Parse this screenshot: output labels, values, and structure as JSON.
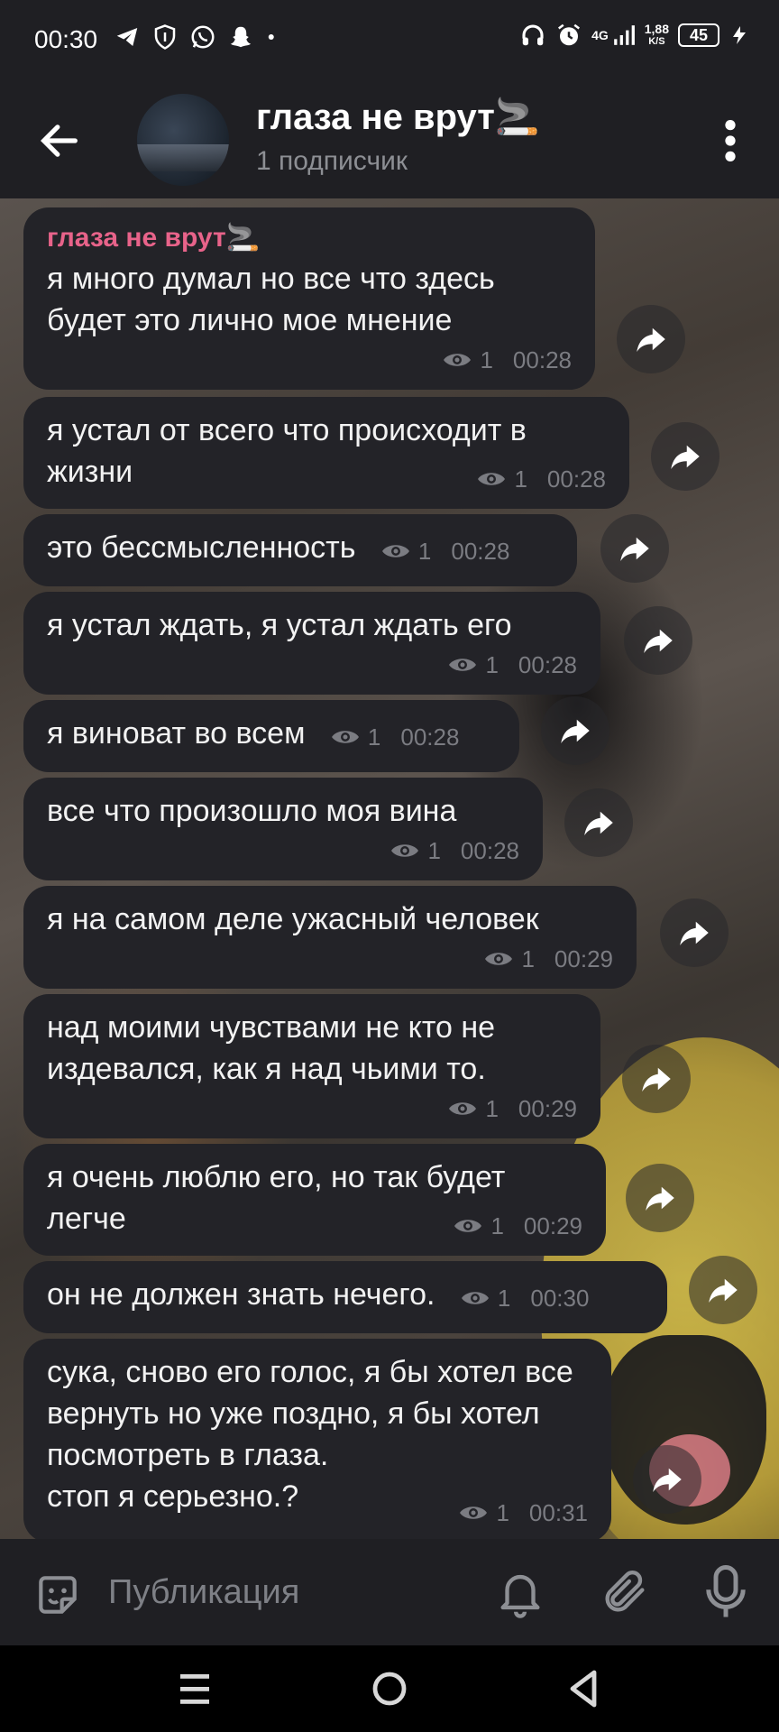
{
  "status_bar": {
    "time": "00:30",
    "network_type": "4G",
    "speed_value": "1,88",
    "speed_unit": "K/S",
    "battery": "45",
    "left_icons": [
      "telegram-icon",
      "shield-icon",
      "whatsapp-icon",
      "snapchat-icon",
      "dot-icon"
    ],
    "right_icons": [
      "headphones-icon",
      "alarm-icon",
      "signal-icon",
      "charging-icon"
    ]
  },
  "header": {
    "channel_name": "глаза не врут🚬",
    "subtitle": "1 подписчик"
  },
  "messages": [
    {
      "author": "глаза не врут🚬",
      "text": "я много думал но все что здесь будет это лично мое мнение",
      "views": "1",
      "time": "00:28"
    },
    {
      "text": "я устал от всего что происходит в жизни",
      "views": "1",
      "time": "00:28"
    },
    {
      "text": "это бессмысленность",
      "views": "1",
      "time": "00:28"
    },
    {
      "text": "я устал ждать, я устал ждать его",
      "views": "1",
      "time": "00:28"
    },
    {
      "text": "я виноват во всем",
      "views": "1",
      "time": "00:28"
    },
    {
      "text": "все что произошло моя вина",
      "views": "1",
      "time": "00:28"
    },
    {
      "text": "я на самом деле ужасный человек",
      "views": "1",
      "time": "00:29"
    },
    {
      "text": "над моими чувствами не кто не издевался, как я над чьими то.",
      "views": "1",
      "time": "00:29"
    },
    {
      "text": "я очень люблю его, но так будет легче",
      "views": "1",
      "time": "00:29"
    },
    {
      "text": "он не должен знать нечего.",
      "views": "1",
      "time": "00:30"
    },
    {
      "text": "сука, сново его голос, я бы хотел все вернуть но уже поздно, я бы хотел посмотреть в глаза.\nстоп я серьезно.?",
      "views": "1",
      "time": "00:31"
    }
  ],
  "input": {
    "placeholder": "Публикация"
  },
  "colors": {
    "background": "#1f1f23",
    "bubble": "#232328",
    "author": "#e8638a",
    "meta": "#7b7c82"
  }
}
